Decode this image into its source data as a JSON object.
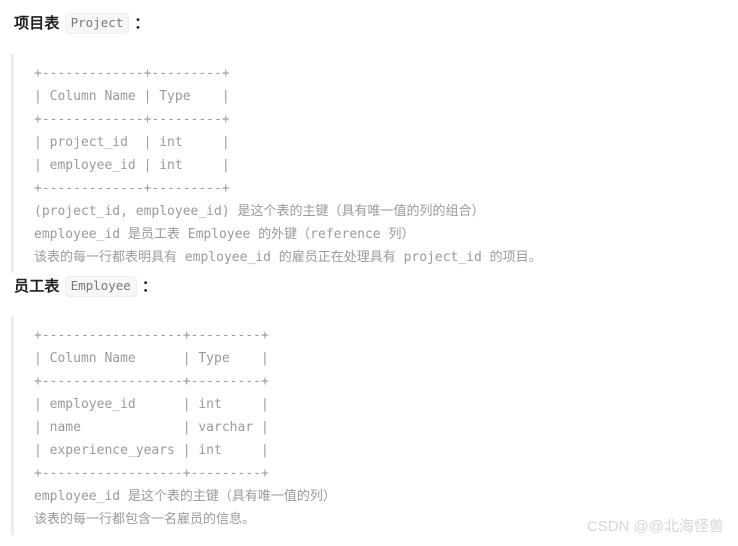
{
  "page": {
    "background_color": "#ffffff",
    "code_text_color": "#9b9b9b",
    "heading_text_color": "#1f1f1f",
    "code_border_color": "#ededed",
    "inline_code_bg": "#f7f7f9",
    "watermark_color": "#d6d6d6"
  },
  "sections": [
    {
      "heading": {
        "label": "项目表",
        "code_name": "Project",
        "colon": "："
      },
      "code": "+-------------+---------+\n| Column Name | Type    |\n+-------------+---------+\n| project_id  | int     |\n| employee_id | int     |\n+-------------+---------+\n(project_id, employee_id) 是这个表的主键（具有唯一值的列的组合）\nemployee_id 是员工表 Employee 的外键（reference 列）\n该表的每一行都表明具有 employee_id 的雇员正在处理具有 project_id 的项目。",
      "table": {
        "headers": [
          "Column Name",
          "Type"
        ],
        "rows": [
          [
            "project_id",
            "int"
          ],
          [
            "employee_id",
            "int"
          ]
        ],
        "notes": [
          "(project_id, employee_id) 是这个表的主键（具有唯一值的列的组合）",
          "employee_id 是员工表 Employee 的外键（reference 列）",
          "该表的每一行都表明具有 employee_id 的雇员正在处理具有 project_id 的项目。"
        ]
      }
    },
    {
      "heading": {
        "label": "员工表",
        "code_name": "Employee",
        "colon": "："
      },
      "code": "+------------------+---------+\n| Column Name      | Type    |\n+------------------+---------+\n| employee_id      | int     |\n| name             | varchar |\n| experience_years | int     |\n+------------------+---------+\nemployee_id 是这个表的主键（具有唯一值的列）\n该表的每一行都包含一名雇员的信息。",
      "table": {
        "headers": [
          "Column Name",
          "Type"
        ],
        "rows": [
          [
            "employee_id",
            "int"
          ],
          [
            "name",
            "varchar"
          ],
          [
            "experience_years",
            "int"
          ]
        ],
        "notes": [
          "employee_id 是这个表的主键（具有唯一值的列）",
          "该表的每一行都包含一名雇员的信息。"
        ]
      }
    }
  ],
  "watermark": {
    "text": "CSDN @@北海怪兽"
  }
}
